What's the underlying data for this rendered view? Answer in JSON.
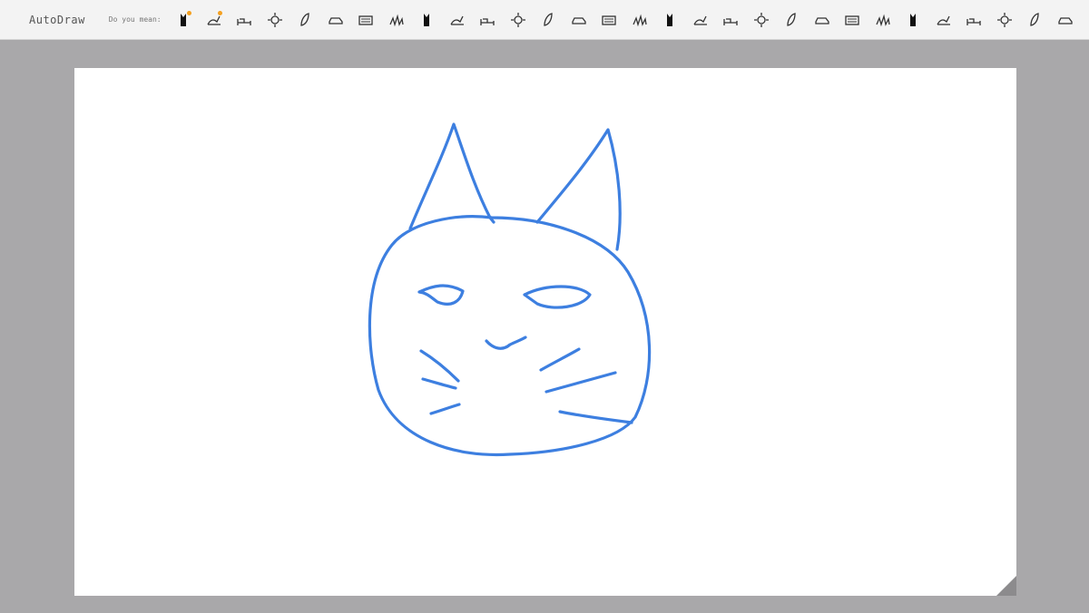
{
  "app": {
    "title": "AutoDraw"
  },
  "toolbar": {
    "prompt_label": "Do you mean:",
    "suggestions": [
      {
        "name": "cat-silhouette-icon",
        "highlighted": true
      },
      {
        "name": "cat-outline-icon",
        "highlighted": true
      },
      {
        "name": "bed-icon"
      },
      {
        "name": "sun-icon"
      },
      {
        "name": "leaf-icon"
      },
      {
        "name": "car-icon"
      },
      {
        "name": "radio-icon"
      },
      {
        "name": "grass-icon"
      },
      {
        "name": "rabbit-sitting-icon"
      },
      {
        "name": "rabbit-icon"
      },
      {
        "name": "rabbit-face-icon"
      },
      {
        "name": "toaster-icon"
      },
      {
        "name": "cake-icon"
      },
      {
        "name": "truck-icon"
      },
      {
        "name": "birthday-cake-icon"
      },
      {
        "name": "flask-icon"
      },
      {
        "name": "basket-icon"
      },
      {
        "name": "battery-icon"
      },
      {
        "name": "bottle-icon"
      },
      {
        "name": "lipstick-icon"
      },
      {
        "name": "phone-icon"
      },
      {
        "name": "speech-bubble-icon"
      },
      {
        "name": "bicycle-icon"
      },
      {
        "name": "soccer-ball-icon"
      },
      {
        "name": "target-icon"
      },
      {
        "name": "basketball-icon"
      },
      {
        "name": "glasses-icon"
      },
      {
        "name": "swan-icon"
      },
      {
        "name": "teapot-icon"
      },
      {
        "name": "hammer-icon"
      }
    ]
  },
  "drawing": {
    "stroke_color": "#3d7fe0",
    "subject": "cat-face-sketch"
  },
  "colors": {
    "toolbar_bg": "#f3f3f3",
    "workspace_bg": "#a9a8aa",
    "canvas_bg": "#ffffff",
    "accent_dot": "#f4a020"
  }
}
